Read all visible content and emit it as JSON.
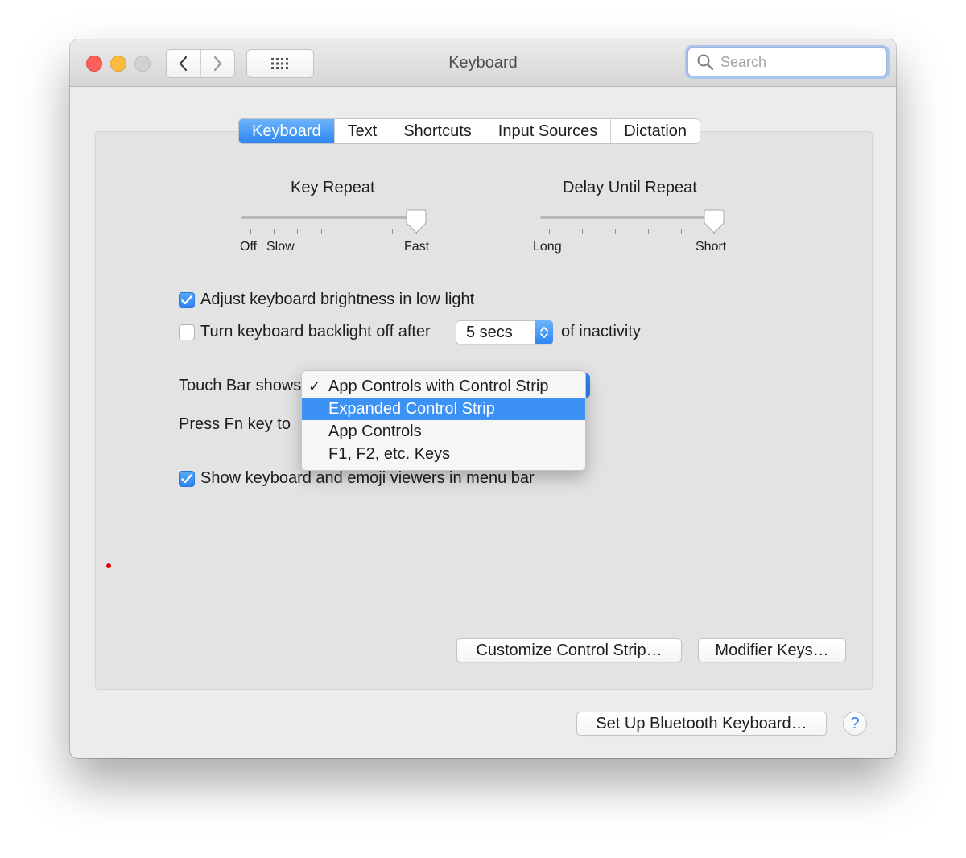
{
  "window": {
    "title": "Keyboard",
    "search_placeholder": "Search"
  },
  "tabs": [
    {
      "label": "Keyboard",
      "active": true
    },
    {
      "label": "Text",
      "active": false
    },
    {
      "label": "Shortcuts",
      "active": false
    },
    {
      "label": "Input Sources",
      "active": false
    },
    {
      "label": "Dictation",
      "active": false
    }
  ],
  "key_repeat": {
    "title": "Key Repeat",
    "labels": [
      "Off",
      "Slow",
      "Fast"
    ],
    "value_fraction": 1.0
  },
  "delay_until_repeat": {
    "title": "Delay Until Repeat",
    "labels": [
      "Long",
      "Short"
    ],
    "value_fraction": 1.0
  },
  "options": {
    "adjust_brightness": {
      "label": "Adjust keyboard brightness in low light",
      "checked": true
    },
    "backlight_off": {
      "label": "Turn keyboard backlight off after",
      "checked": false,
      "value": "5 secs",
      "suffix": "of inactivity"
    },
    "touch_bar_shows": {
      "label": "Touch Bar shows"
    },
    "press_fn": {
      "label": "Press Fn key to"
    },
    "show_viewers": {
      "label": "Show keyboard and emoji viewers in menu bar",
      "checked": true
    }
  },
  "dropdown_menu": {
    "items": [
      {
        "label": "App Controls with Control Strip",
        "checked": true,
        "highlighted": false
      },
      {
        "label": "Expanded Control Strip",
        "checked": false,
        "highlighted": true
      },
      {
        "label": "App Controls",
        "checked": false,
        "highlighted": false
      },
      {
        "label": "F1, F2, etc. Keys",
        "checked": false,
        "highlighted": false
      }
    ]
  },
  "buttons": {
    "customize_control_strip": "Customize Control Strip…",
    "modifier_keys": "Modifier Keys…",
    "setup_bluetooth": "Set Up Bluetooth Keyboard…",
    "help": "?"
  },
  "colors": {
    "accent": "#2f86f2",
    "highlight": "#3c91f5"
  }
}
